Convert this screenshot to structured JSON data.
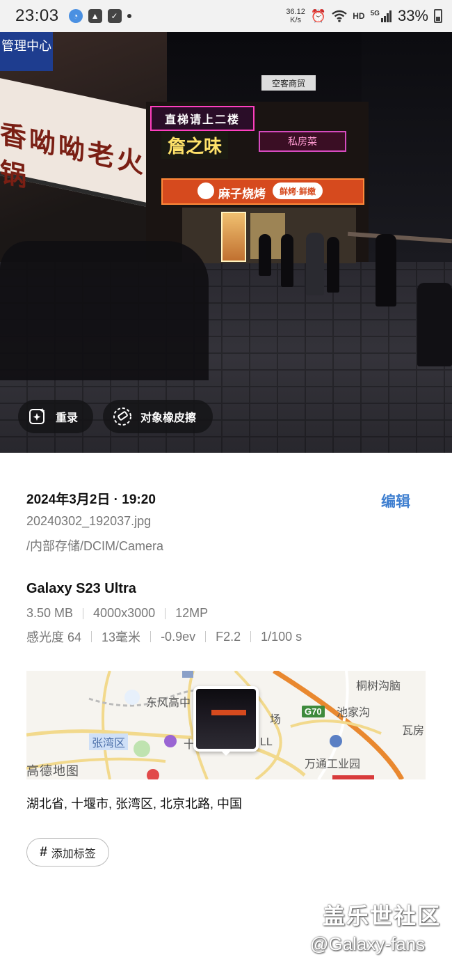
{
  "status_bar": {
    "time": "23:03",
    "net_speed": "36.12",
    "net_speed_unit": "K/s",
    "hd": "HD",
    "network": "5G",
    "battery": "33%",
    "icons_left": [
      "qq-icon",
      "gallery-icon",
      "check-icon"
    ],
    "icons_right": [
      "alarm-icon",
      "wifi-icon",
      "signal-icon",
      "battery-icon"
    ]
  },
  "photo": {
    "scene": {
      "sign_top_left": "管理中心",
      "banner": "香呦呦老火锅",
      "neon_top": "直梯请上二楼",
      "neon_main": "詹之味",
      "neon_right": "私房菜",
      "shop": "麻子烧烤",
      "shop_badge": "鲜烤·鲜嫩",
      "top_sign": "空客商贸"
    },
    "buttons": {
      "remaster": "重录",
      "eraser": "对象橡皮擦"
    }
  },
  "details": {
    "datetime": "2024年3月2日 · 19:20",
    "edit": "编辑",
    "filename": "20240302_192037.jpg",
    "path": "/内部存储/DCIM/Camera",
    "device": "Galaxy S23 Ultra",
    "specs_row1": [
      "3.50 MB",
      "4000x3000",
      "12MP"
    ],
    "specs_row2": [
      "感光度 64",
      "13毫米",
      "-0.9ev",
      "F2.2",
      "1/100 s"
    ]
  },
  "map": {
    "labels": {
      "dongfeng": "东风高中",
      "zhangwan": "张湾区",
      "shiyan": "十",
      "mall_suffix": "LL",
      "plaza": "场",
      "tongshu": "桐树沟脑",
      "chijia": "池家沟",
      "wafang": "瓦房",
      "wantong": "万通工业园",
      "g70": "G70",
      "watermark": "高德地图"
    }
  },
  "address": "湖北省, 十堰市, 张湾区, 北京北路, 中国",
  "tag_button": "添加标签",
  "watermark": {
    "line1": "盖乐世社区",
    "line2": "@Galaxy-fans"
  }
}
